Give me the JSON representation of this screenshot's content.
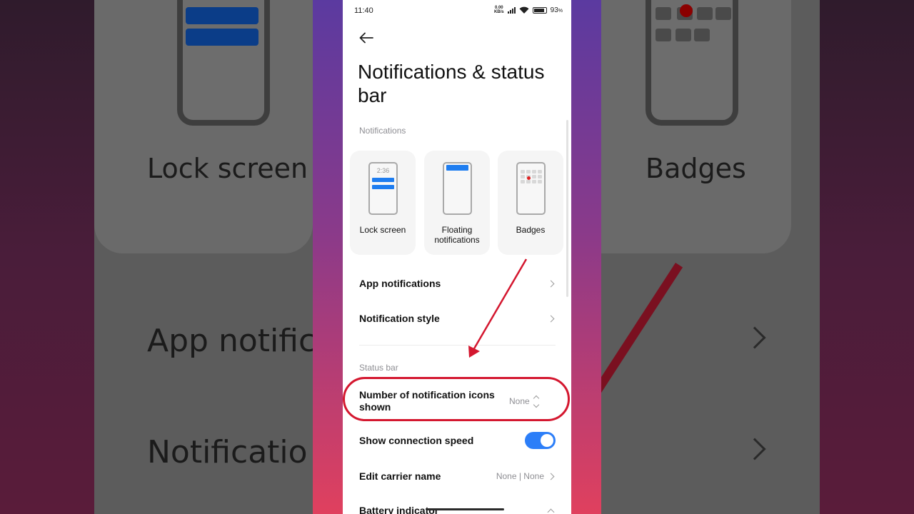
{
  "background": {
    "left_label": "Lock screen",
    "left_row1": "App notifica",
    "left_row2": "Notificatio",
    "right_label": "Badges"
  },
  "status_bar": {
    "time": "11:40",
    "speed_value": "0.00",
    "speed_unit": "KB/s",
    "battery": "93",
    "battery_suffix": "%"
  },
  "page": {
    "title": "Notifications & status bar"
  },
  "notifications_section": {
    "label": "Notifications",
    "cards": [
      {
        "label": "Lock screen",
        "preview_time": "2:36"
      },
      {
        "label": "Floating notifications"
      },
      {
        "label": "Badges"
      }
    ]
  },
  "rows_top": [
    {
      "label": "App notifications"
    },
    {
      "label": "Notification style"
    }
  ],
  "status_bar_section": {
    "label": "Status bar",
    "rows": [
      {
        "label": "Number of notification icons shown",
        "value": "None"
      },
      {
        "label": "Show connection speed",
        "toggle": true
      },
      {
        "label": "Edit carrier name",
        "value": "None | None"
      },
      {
        "label": "Battery indicator"
      }
    ]
  },
  "colors": {
    "accent": "#2C7EF8",
    "highlight": "#D4172F",
    "preview_bar": "#1E7DF0"
  }
}
